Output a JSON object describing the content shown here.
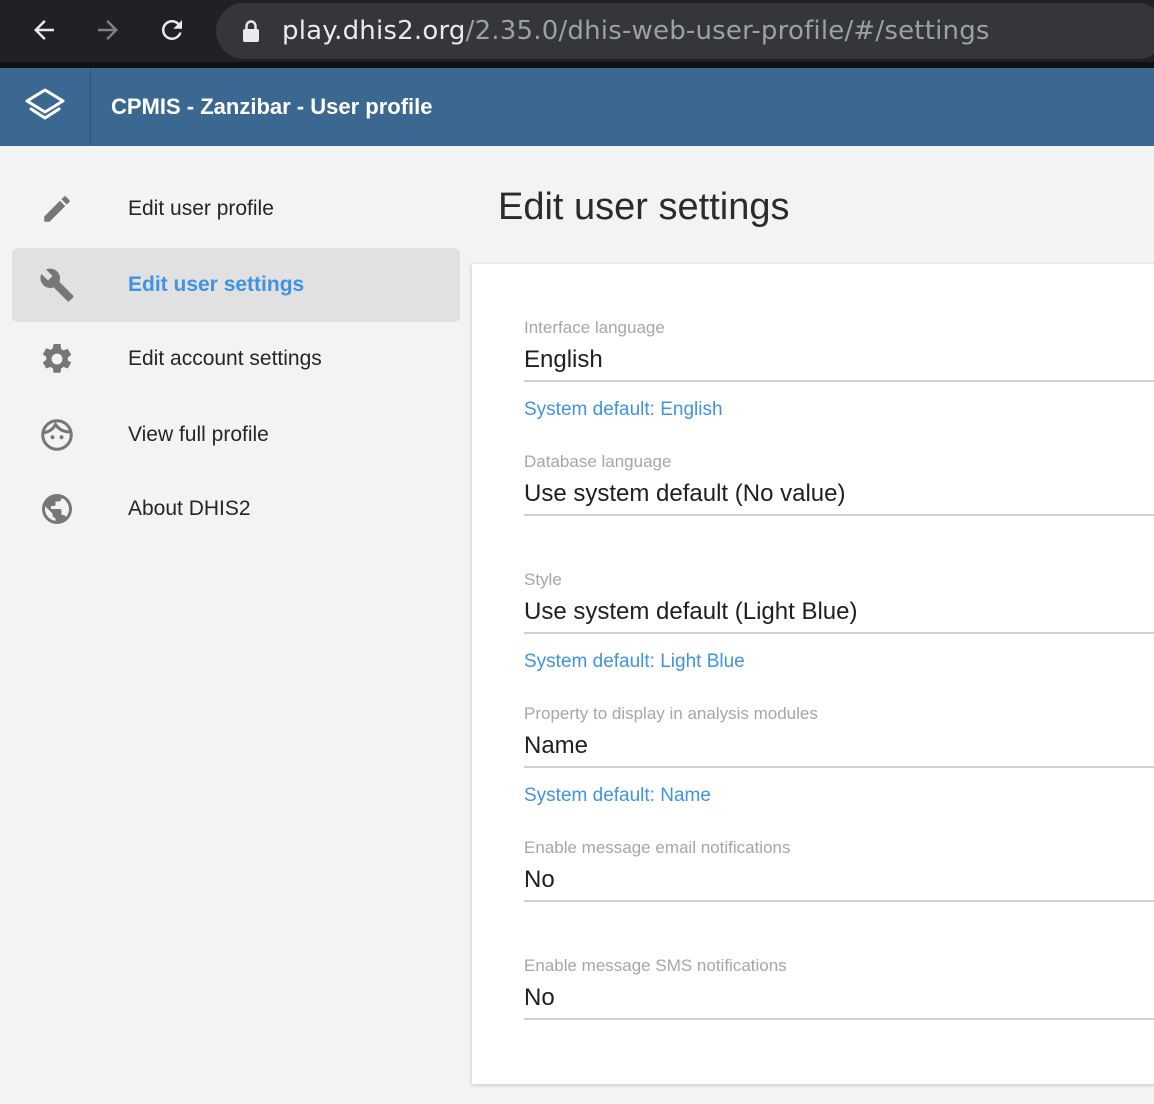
{
  "browser": {
    "url_host": "play.dhis2.org",
    "url_path": "/2.35.0/dhis-web-user-profile/#/settings"
  },
  "header": {
    "title": "CPMIS - Zanzibar - User profile",
    "logo_icon": "dhis2-logo-icon"
  },
  "sidebar": {
    "items": [
      {
        "label": "Edit user profile",
        "icon": "pencil-icon",
        "active": false
      },
      {
        "label": "Edit user settings",
        "icon": "wrench-icon",
        "active": true
      },
      {
        "label": "Edit account settings",
        "icon": "gear-icon",
        "active": false
      },
      {
        "label": "View full profile",
        "icon": "face-icon",
        "active": false
      },
      {
        "label": "About DHIS2",
        "icon": "globe-icon",
        "active": false
      }
    ]
  },
  "main": {
    "title": "Edit user settings",
    "fields": [
      {
        "label": "Interface language",
        "value": "English",
        "hint": "System default: English"
      },
      {
        "label": "Database language",
        "value": "Use system default (No value)",
        "hint": ""
      },
      {
        "label": "Style",
        "value": "Use system default (Light Blue)",
        "hint": "System default: Light Blue"
      },
      {
        "label": "Property to display in analysis modules",
        "value": "Name",
        "hint": "System default: Name"
      },
      {
        "label": "Enable message email notifications",
        "value": "No",
        "hint": ""
      },
      {
        "label": "Enable message SMS notifications",
        "value": "No",
        "hint": ""
      }
    ]
  },
  "colors": {
    "header_bg": "#3b6891",
    "accent": "#3f93e0",
    "active_item_bg": "#e1e1e1"
  }
}
